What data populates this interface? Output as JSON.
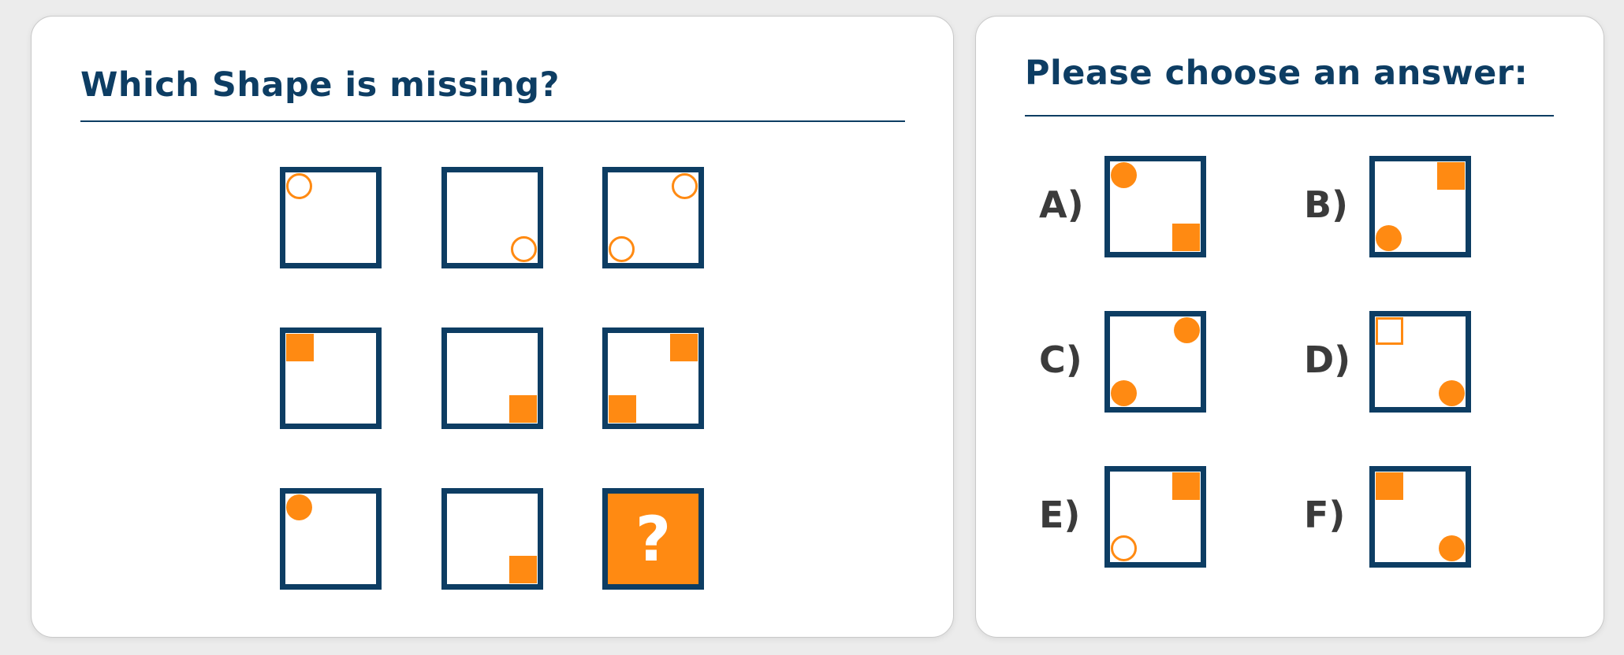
{
  "question_panel": {
    "title": "Which Shape is missing?",
    "grid": [
      {
        "marks": [
          {
            "shape": "circle-outline",
            "corner": "tl"
          }
        ]
      },
      {
        "marks": [
          {
            "shape": "circle-outline",
            "corner": "br"
          }
        ]
      },
      {
        "marks": [
          {
            "shape": "circle-outline",
            "corner": "tr"
          },
          {
            "shape": "circle-outline",
            "corner": "bl"
          }
        ]
      },
      {
        "marks": [
          {
            "shape": "square-solid",
            "corner": "tl"
          }
        ]
      },
      {
        "marks": [
          {
            "shape": "square-solid",
            "corner": "br"
          }
        ]
      },
      {
        "marks": [
          {
            "shape": "square-solid",
            "corner": "tr"
          },
          {
            "shape": "square-solid",
            "corner": "bl"
          }
        ]
      },
      {
        "marks": [
          {
            "shape": "circle-solid",
            "corner": "tl"
          }
        ]
      },
      {
        "marks": [
          {
            "shape": "square-solid",
            "corner": "br"
          }
        ]
      },
      {
        "question": "?"
      }
    ]
  },
  "answer_panel": {
    "title": "Please choose an answer:",
    "options": [
      {
        "label": "A)",
        "marks": [
          {
            "shape": "circle-solid",
            "corner": "tl"
          },
          {
            "shape": "square-solid",
            "corner": "br"
          }
        ]
      },
      {
        "label": "B)",
        "marks": [
          {
            "shape": "square-solid",
            "corner": "tr"
          },
          {
            "shape": "circle-solid",
            "corner": "bl"
          }
        ]
      },
      {
        "label": "C)",
        "marks": [
          {
            "shape": "circle-solid",
            "corner": "tr"
          },
          {
            "shape": "circle-solid",
            "corner": "bl"
          }
        ]
      },
      {
        "label": "D)",
        "marks": [
          {
            "shape": "square-outline",
            "corner": "tl"
          },
          {
            "shape": "circle-solid",
            "corner": "br"
          }
        ]
      },
      {
        "label": "E)",
        "marks": [
          {
            "shape": "square-solid",
            "corner": "tr"
          },
          {
            "shape": "circle-outline",
            "corner": "bl"
          }
        ]
      },
      {
        "label": "F)",
        "marks": [
          {
            "shape": "square-solid",
            "corner": "tl"
          },
          {
            "shape": "circle-solid",
            "corner": "br"
          }
        ]
      }
    ]
  },
  "colors": {
    "frame": "#0d3d63",
    "accent": "#ff8a12",
    "label": "#3b3b3b"
  }
}
